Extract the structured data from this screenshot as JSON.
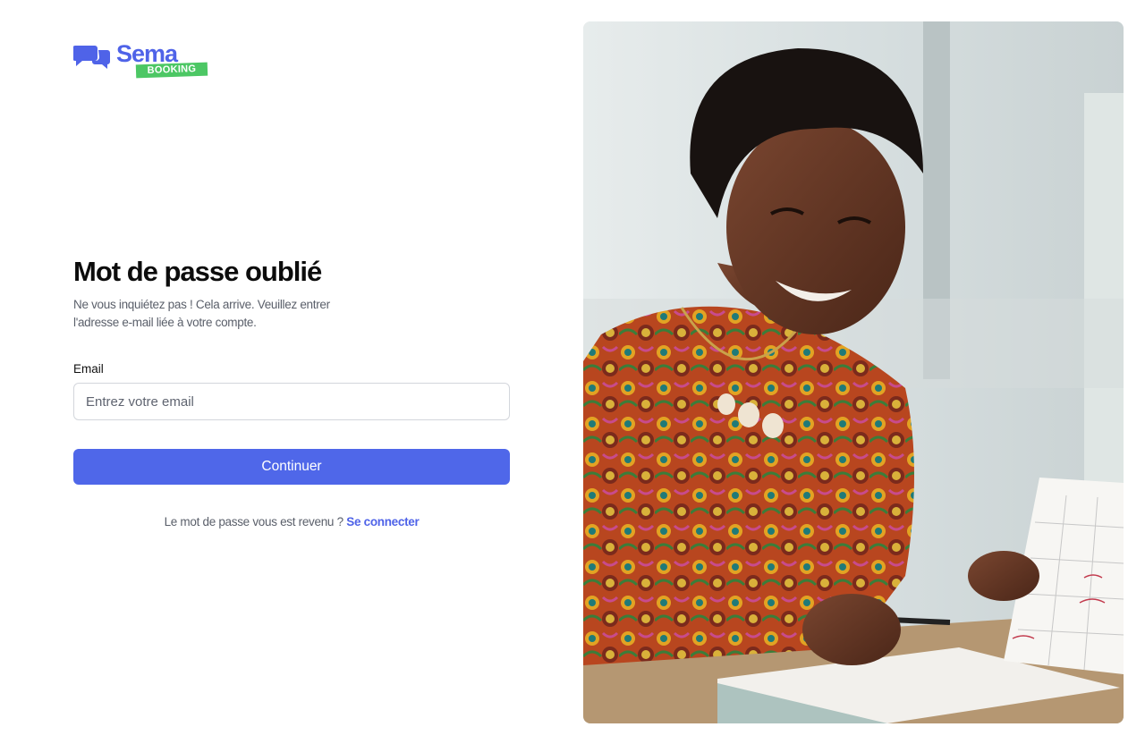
{
  "brand": {
    "name": "Sema",
    "tag": "BOOKING",
    "colors": {
      "primary": "#4f63e8",
      "tag": "#4cc764"
    }
  },
  "form": {
    "title": "Mot de passe oublié",
    "subtitle": "Ne vous inquiétez pas ! Cela arrive. Veuillez entrer l'adresse e-mail liée à votre compte.",
    "email_label": "Email",
    "email_placeholder": "Entrez votre email",
    "email_value": "",
    "submit_label": "Continuer",
    "footer_text": "Le mot de passe vous est revenu ?",
    "footer_link": "Se connecter"
  },
  "hero": {
    "image": "woman-with-calendar-photo"
  }
}
